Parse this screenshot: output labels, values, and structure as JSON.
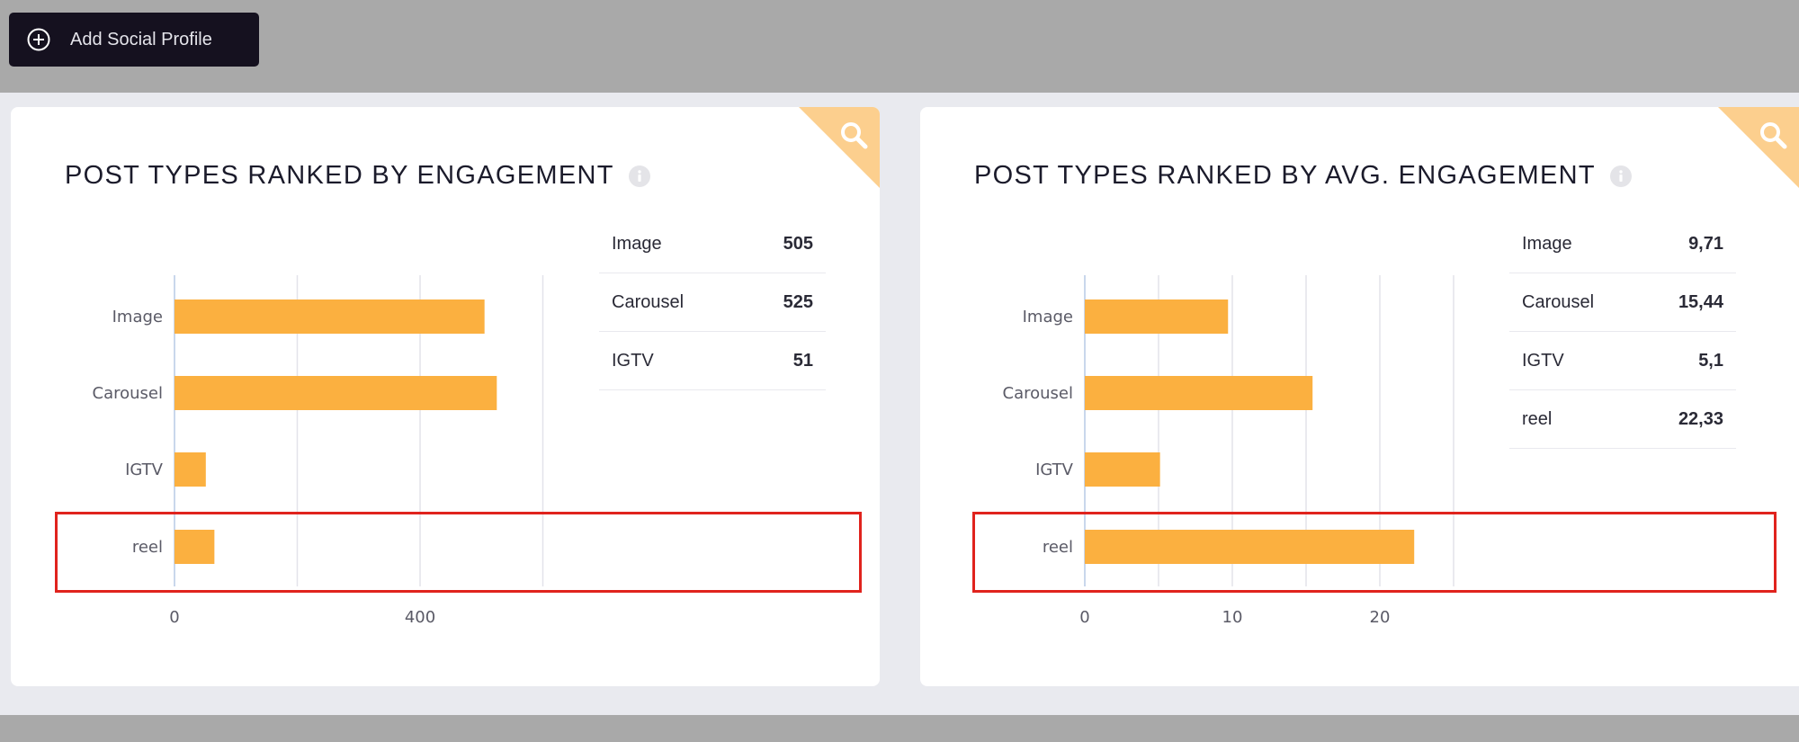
{
  "toolbar": {
    "add_profile_label": "Add Social Profile"
  },
  "colors": {
    "bar": "#fbb040",
    "accent_corner": "#fccf8e",
    "highlight": "#e0231d",
    "button_bg": "#15111f"
  },
  "icons": [
    "plus-circle-icon",
    "search-icon",
    "info-icon"
  ],
  "cards": [
    {
      "title": "POST TYPES RANKED BY ENGAGEMENT",
      "table": [
        {
          "label": "Image",
          "value": "505"
        },
        {
          "label": "Carousel",
          "value": "525"
        },
        {
          "label": "IGTV",
          "value": "51"
        }
      ]
    },
    {
      "title": "POST TYPES RANKED BY AVG. ENGAGEMENT",
      "table": [
        {
          "label": "Image",
          "value": "9,71"
        },
        {
          "label": "Carousel",
          "value": "15,44"
        },
        {
          "label": "IGTV",
          "value": "5,1"
        },
        {
          "label": "reel",
          "value": "22,33"
        }
      ]
    }
  ],
  "chart_data": [
    {
      "type": "bar",
      "orientation": "horizontal",
      "categories": [
        "Image",
        "Carousel",
        "IGTV",
        "reel"
      ],
      "values": [
        505,
        525,
        51,
        65
      ],
      "xlim": [
        0,
        600
      ],
      "xticks": [
        0,
        400
      ],
      "grid": true
    },
    {
      "type": "bar",
      "orientation": "horizontal",
      "categories": [
        "Image",
        "Carousel",
        "IGTV",
        "reel"
      ],
      "values": [
        9.71,
        15.44,
        5.1,
        22.33
      ],
      "xlim": [
        0,
        25
      ],
      "xticks": [
        0,
        10,
        20
      ],
      "grid": true
    }
  ]
}
